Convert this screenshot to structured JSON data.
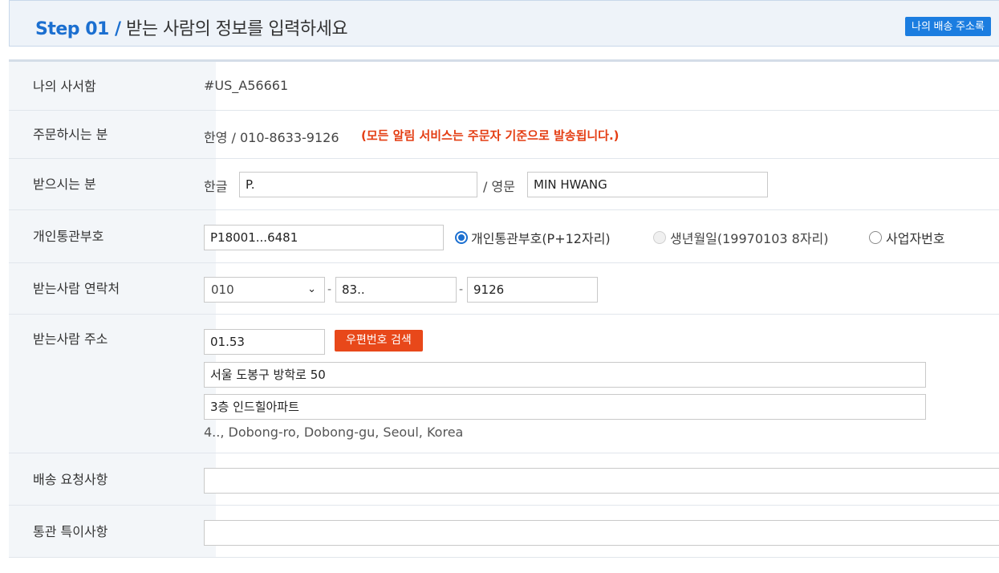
{
  "header": {
    "step": "Step 01 /",
    "title": "받는 사람의 정보를 입력하세요",
    "address_book_button": "나의 배송 주소록"
  },
  "rows": {
    "po_box": {
      "label": "나의 사서함",
      "value": "#US_A56661"
    },
    "orderer": {
      "label": "주문하시는 분",
      "value": "한영 / 010-8633-9126",
      "notice": "(모든 알림 서비스는 주문자 기준으로 발송됩니다.)"
    },
    "recipient": {
      "label": "받으시는 분",
      "korean_label": "한글",
      "korean_value": "P.",
      "english_label": "/ 영문",
      "english_value": "MIN HWANG"
    },
    "customs": {
      "label": "개인통관부호",
      "value": "P18001...6481",
      "options": [
        {
          "label": "개인통관부호(P+12자리)",
          "state": "checked"
        },
        {
          "label": "생년월일(19970103 8자리)",
          "state": "disabled"
        },
        {
          "label": "사업자번호",
          "state": "unchecked"
        }
      ]
    },
    "contact": {
      "label": "받는사람 연락처",
      "prefix": "010",
      "middle": "83..",
      "last": "9126",
      "separator": "-"
    },
    "address": {
      "label": "받는사람 주소",
      "zipcode": "01.53",
      "zip_button": "우편번호 검색",
      "line1": "서울 도봉구 방학로 50",
      "line2": "3층 인드힐아파트",
      "english": "4.., Dobong-ro, Dobong-gu, Seoul, Korea"
    },
    "delivery_request": {
      "label": "배송 요청사항",
      "value": ""
    },
    "customs_notes": {
      "label": "통관 특이사항",
      "value": ""
    }
  },
  "colors": {
    "accent": "#1b6fd0",
    "warning": "#e43d12",
    "button_orange": "#e8481a"
  }
}
